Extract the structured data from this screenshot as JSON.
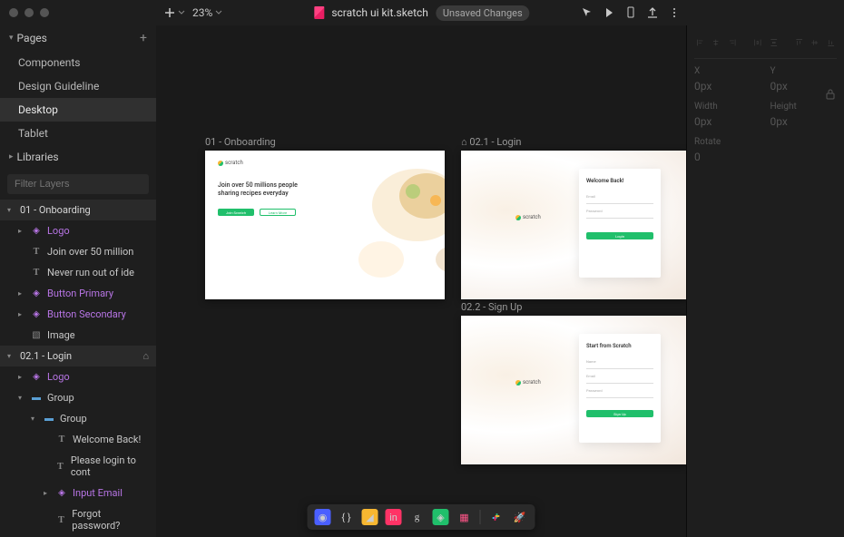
{
  "app": {
    "file_title": "scratch ui kit.sketch",
    "save_badge": "Unsaved Changes",
    "zoom": "23%"
  },
  "pages_panel": {
    "title": "Pages",
    "items": [
      "Components",
      "Design Guideline",
      "Desktop",
      "Tablet"
    ],
    "selected_index": 2
  },
  "libraries_panel": {
    "title": "Libraries"
  },
  "filter": {
    "placeholder": "Filter Layers"
  },
  "layers": [
    {
      "type": "artboard",
      "label": "01 - Onboarding",
      "indent": 0
    },
    {
      "type": "symbol",
      "label": "Logo",
      "indent": 1
    },
    {
      "type": "text",
      "label": "Join over 50 million",
      "indent": 1
    },
    {
      "type": "text",
      "label": "Never run out of ide",
      "indent": 1
    },
    {
      "type": "symbol",
      "label": "Button Primary",
      "indent": 1
    },
    {
      "type": "symbol",
      "label": "Button Secondary",
      "indent": 1
    },
    {
      "type": "image",
      "label": "Image",
      "indent": 1
    },
    {
      "type": "artboard",
      "label": "02.1 - Login",
      "indent": 0,
      "home": true
    },
    {
      "type": "symbol",
      "label": "Logo",
      "indent": 1
    },
    {
      "type": "folder",
      "label": "Group",
      "indent": 1
    },
    {
      "type": "folder",
      "label": "Group",
      "indent": 2
    },
    {
      "type": "text",
      "label": "Welcome Back!",
      "indent": 3
    },
    {
      "type": "text",
      "label": "Please login to cont",
      "indent": 3
    },
    {
      "type": "symbol",
      "label": "Input Email",
      "indent": 3
    },
    {
      "type": "text",
      "label": "Forgot password?",
      "indent": 3
    }
  ],
  "artboards": {
    "onboarding": {
      "label": "01 - Onboarding",
      "logo": "scratch",
      "headline": "Join over 50 millions people sharing recipes everyday",
      "btn_primary": "Join Scratch",
      "btn_secondary": "Learn More"
    },
    "login": {
      "label": "02.1 - Login",
      "logo": "scratch",
      "card_title": "Welcome Back!",
      "btn": "Login"
    },
    "signup": {
      "label": "02.2 - Sign Up",
      "logo": "scratch",
      "card_title": "Start from Scratch",
      "btn": "Sign Up"
    }
  },
  "inspector": {
    "x_label": "X",
    "x_value": "0px",
    "y_label": "Y",
    "y_value": "0px",
    "w_label": "Width",
    "w_value": "0px",
    "h_label": "Height",
    "h_value": "0px",
    "r_label": "Rotate",
    "r_value": "0"
  },
  "dock": {
    "icons": [
      "abstract",
      "code",
      "zeplin",
      "invision",
      "gravit",
      "craft",
      "grid",
      "slack",
      "runner"
    ]
  }
}
